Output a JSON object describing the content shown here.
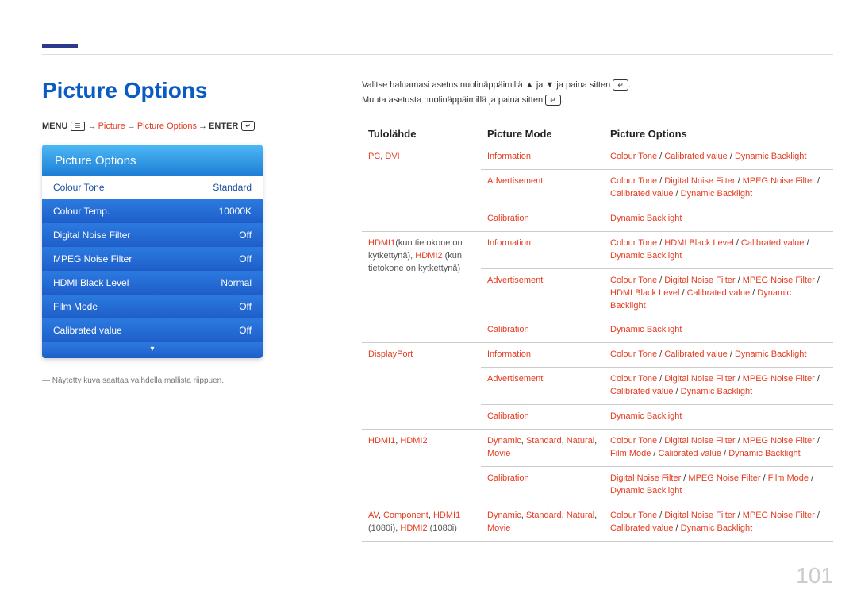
{
  "page_number": "101",
  "title": "Picture Options",
  "breadcrumb": {
    "menu_label": "MENU",
    "p1": "Picture",
    "p2": "Picture Options",
    "enter_label": "ENTER"
  },
  "osd": {
    "header": "Picture Options",
    "rows": [
      {
        "label": "Colour Tone",
        "value": "Standard",
        "selected": true
      },
      {
        "label": "Colour Temp.",
        "value": "10000K",
        "selected": false
      },
      {
        "label": "Digital Noise Filter",
        "value": "Off",
        "selected": false
      },
      {
        "label": "MPEG Noise Filter",
        "value": "Off",
        "selected": false
      },
      {
        "label": "HDMI Black Level",
        "value": "Normal",
        "selected": false
      },
      {
        "label": "Film Mode",
        "value": "Off",
        "selected": false
      },
      {
        "label": "Calibrated value",
        "value": "Off",
        "selected": false
      }
    ],
    "foot_glyph": "▾"
  },
  "footnote_text": "― Näytetty kuva saattaa vaihdella mallista riippuen.",
  "instructions": {
    "line1_a": "Valitse haluamasi asetus nuolinäppäimillä ",
    "line1_b": " ja ",
    "line1_c": " ja paina sitten ",
    "line1_d": ".",
    "line2_a": "Muuta asetusta nuolinäppäimillä ja paina sitten ",
    "line2_b": "."
  },
  "glyph_up": "▲",
  "glyph_down": "▼",
  "glyph_enter": "↵",
  "glyph_menu": "☰",
  "table": {
    "h1": "Tulolähde",
    "h2": "Picture Mode",
    "h3": "Picture Options",
    "rows": [
      {
        "src_html": "<span class='red'>PC</span>, <span class='red'>DVI</span>",
        "mode_html": "<span class='red'>Information</span>",
        "opt_html": "<span class='red'>Colour Tone</span> / <span class='red'>Calibrated value</span> / <span class='red'>Dynamic Backlight</span>",
        "rowspan_src": 3
      },
      {
        "mode_html": "<span class='red'>Advertisement</span>",
        "opt_html": "<span class='red'>Colour Tone</span> / <span class='red'>Digital Noise Filter</span> / <span class='red'>MPEG Noise Filter</span> / <span class='red'>Calibrated value</span> / <span class='red'>Dynamic Backlight</span>"
      },
      {
        "mode_html": "<span class='red'>Calibration</span>",
        "opt_html": "<span class='red'>Dynamic Backlight</span>"
      },
      {
        "src_html": "<span class='red'>HDMI1</span><span class='gray'>(kun tietokone on kytkettynä), </span><span class='red'>HDMI2</span><span class='gray'> (kun tietokone on kytkettynä)</span>",
        "mode_html": "<span class='red'>Information</span>",
        "opt_html": "<span class='red'>Colour Tone</span> / <span class='red'>HDMI Black Level</span> / <span class='red'>Calibrated value</span> / <span class='red'>Dynamic Backlight</span>",
        "rowspan_src": 3
      },
      {
        "mode_html": "<span class='red'>Advertisement</span>",
        "opt_html": "<span class='red'>Colour Tone</span> / <span class='red'>Digital Noise Filter</span> / <span class='red'>MPEG Noise Filter</span> / <span class='red'>HDMI Black Level</span> / <span class='red'>Calibrated value</span> / <span class='red'>Dynamic Backlight</span>"
      },
      {
        "mode_html": "<span class='red'>Calibration</span>",
        "opt_html": "<span class='red'>Dynamic Backlight</span>"
      },
      {
        "src_html": "<span class='red'>DisplayPort</span>",
        "mode_html": "<span class='red'>Information</span>",
        "opt_html": "<span class='red'>Colour Tone</span> / <span class='red'>Calibrated value</span> / <span class='red'>Dynamic Backlight</span>",
        "rowspan_src": 3
      },
      {
        "mode_html": "<span class='red'>Advertisement</span>",
        "opt_html": "<span class='red'>Colour Tone</span> / <span class='red'>Digital Noise Filter</span> / <span class='red'>MPEG Noise Filter</span> / <span class='red'>Calibrated value</span> / <span class='red'>Dynamic Backlight</span>"
      },
      {
        "mode_html": "<span class='red'>Calibration</span>",
        "opt_html": "<span class='red'>Dynamic Backlight</span>"
      },
      {
        "src_html": "<span class='red'>HDMI1</span>, <span class='red'>HDMI2</span>",
        "mode_html": "<span class='red'>Dynamic</span>, <span class='red'>Standard</span>, <span class='red'>Natural</span>, <span class='red'>Movie</span>",
        "opt_html": "<span class='red'>Colour Tone</span> / <span class='red'>Digital Noise Filter</span> / <span class='red'>MPEG Noise Filter</span> / <span class='red'>Film Mode</span> / <span class='red'>Calibrated value</span> / <span class='red'>Dynamic Backlight</span>",
        "rowspan_src": 2
      },
      {
        "mode_html": "<span class='red'>Calibration</span>",
        "opt_html": "<span class='red'>Digital Noise Filter</span> / <span class='red'>MPEG Noise Filter</span> / <span class='red'>Film Mode</span> / <span class='red'>Dynamic Backlight</span>"
      },
      {
        "src_html": "<span class='red'>AV</span>, <span class='red'>Component</span>, <span class='red'>HDMI1</span> <span class='gray'>(1080i)</span>, <span class='red'>HDMI2</span> <span class='gray'>(1080i)</span>",
        "mode_html": "<span class='red'>Dynamic</span>, <span class='red'>Standard</span>, <span class='red'>Natural</span>, <span class='red'>Movie</span>",
        "opt_html": "<span class='red'>Colour Tone</span> / <span class='red'>Digital Noise Filter</span> / <span class='red'>MPEG Noise Filter</span> / <span class='red'>Calibrated value</span> / <span class='red'>Dynamic Backlight</span>",
        "rowspan_src": 1
      }
    ]
  }
}
